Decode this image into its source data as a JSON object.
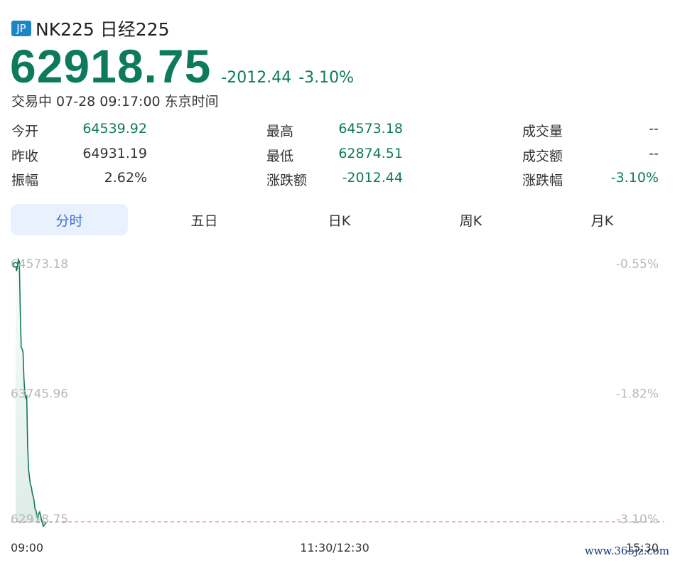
{
  "header": {
    "badge": "JP",
    "title": "NK225 日经225"
  },
  "quote": {
    "price": "62918.75",
    "change": "-2012.44",
    "change_pct": "-3.10%",
    "status": "交易中 07-28 09:17:00 东京时间",
    "accent_color": "#0e7a5c"
  },
  "stats": {
    "open_label": "今开",
    "open_value": "64539.92",
    "prev_close_label": "昨收",
    "prev_close_value": "64931.19",
    "amplitude_label": "振幅",
    "amplitude_value": "2.62%",
    "high_label": "最高",
    "high_value": "64573.18",
    "low_label": "最低",
    "low_value": "62874.51",
    "change_amt_label": "涨跌额",
    "change_amt_value": "-2012.44",
    "volume_label": "成交量",
    "volume_value": "--",
    "turnover_label": "成交额",
    "turnover_value": "--",
    "change_pct_label": "涨跌幅",
    "change_pct_value": "-3.10%"
  },
  "tabs": [
    "分时",
    "五日",
    "日K",
    "周K",
    "月K"
  ],
  "active_tab": "分时",
  "chart_data": {
    "type": "line",
    "y_left_ticks": [
      "64573.18",
      "63745.96",
      "62918.75"
    ],
    "y_right_ticks": [
      "-0.55%",
      "-1.82%",
      "-3.10%"
    ],
    "x_ticks": [
      "09:00",
      "11:30/12:30",
      "15:30"
    ],
    "ylim": [
      62918.75,
      64573.18
    ],
    "reference_line": 62918.75,
    "series": [
      {
        "x": [
          0,
          0.5,
          1,
          1.5,
          2,
          2.5,
          3,
          3.5,
          4,
          4.5,
          5,
          5.5,
          6,
          6.5,
          7,
          7.5,
          8,
          8.5,
          9,
          9.5,
          10,
          10.5,
          11,
          11.5,
          12,
          12.5,
          13,
          13.5,
          14,
          15,
          16,
          17
        ],
        "values": [
          64540,
          64500,
          64530,
          64573,
          64560,
          64250,
          64020,
          64010,
          63990,
          63820,
          63730,
          63700,
          63710,
          63400,
          63250,
          63200,
          63150,
          63140,
          63100,
          63080,
          63050,
          63000,
          62990,
          62960,
          62930,
          62970,
          62980,
          62960,
          62930,
          62890,
          62905,
          62918.75
        ]
      }
    ],
    "line_color": "#0e7a5c",
    "ref_color": "#e88a9a"
  },
  "watermark": "www.365jz.com"
}
